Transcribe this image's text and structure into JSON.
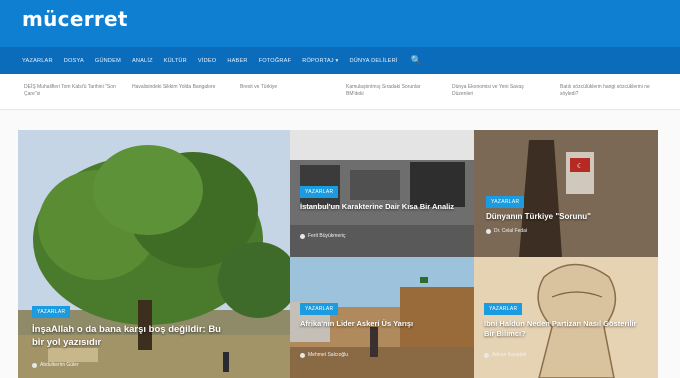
{
  "site": {
    "logo": "mücerret"
  },
  "nav": {
    "items": [
      "YAZARLAR",
      "DOSYA",
      "GÜNDEM",
      "ANALİZ",
      "KÜLTÜR",
      "VİDEO",
      "HABER",
      "FOTOĞRAF",
      "RÖPORTAJ ▾",
      "DÜNYA DELİLERİ"
    ],
    "search_icon": "🔍"
  },
  "ticker": [
    "DEİŞ Muhalifleri Tom Kalsi'ü Tarihini \"Son Çare\"si",
    "Havalisindeki Sikkim Yolda Bangalore",
    "Brexit ve Türkiye",
    "Kamulaştırılmış Sıradaki Sorunlar BM'deki",
    "Dünya Ekonomisi ve Yeni Savaş Düzenleri",
    "Batılı sözcülüklerin hangi sözcüklerini ne söyledi?"
  ],
  "cards": [
    {
      "category": "YAZARLAR",
      "title": "İnşaAllah o da bana karşı boş değildir: Bu bir yol yazısıdır",
      "author": "Abdulkerim Güler"
    },
    {
      "category": "YAZARLAR",
      "title": "İstanbul'un Karakterine Dair Kısa Bir Analiz",
      "author": "Ferit Büyükmeriç"
    },
    {
      "category": "YAZARLAR",
      "title": "Dünyanın Türkiye \"Sorunu\"",
      "author": "Dr. Celal Fedai"
    },
    {
      "category": "YAZARLAR",
      "title": "Afrika'nın Lider Askeri Üs Yarışı",
      "author": "Mehmet Salcıoğlu"
    },
    {
      "category": "YAZARLAR",
      "title": "İbni Haldun Neden Partizan Nasıl Gösterilir Bir Bilimci?",
      "author": "Adnan Karadeli"
    }
  ],
  "colors": {
    "header": "#0f7fd1",
    "nav": "#0b6cbc",
    "badge": "#1b9be0"
  }
}
